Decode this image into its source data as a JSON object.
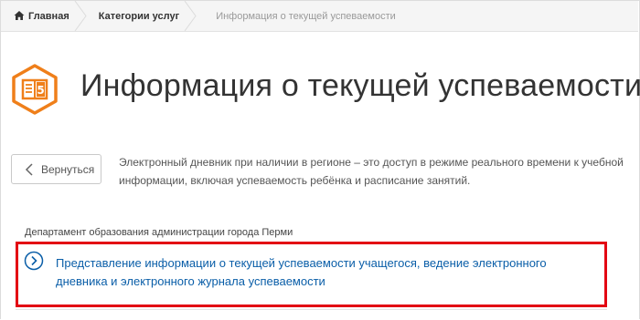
{
  "breadcrumb": {
    "home": "Главная",
    "categories": "Категории услуг",
    "current": "Информация о текущей успеваемости"
  },
  "page": {
    "title": "Информация о текущей успеваемости",
    "title_icon": "gradebook-icon",
    "title_icon_digit": "5"
  },
  "back_button": {
    "label": "Вернуться"
  },
  "description": {
    "line1": "Электронный дневник при наличии в регионе – это доступ в режиме реального времени к учебной",
    "line2": "информации, включая успеваемость ребёнка и расписание занятий."
  },
  "department": "Департамент образования администрации города Перми",
  "service": {
    "line1": "Представление информации о текущей успеваемости учащегося, ведение электронного",
    "line2": "дневника и электронного журнала успеваемости"
  },
  "colors": {
    "accent_orange": "#ef7f1a",
    "link_blue": "#0a5ea8",
    "highlight_red": "#e30613"
  }
}
